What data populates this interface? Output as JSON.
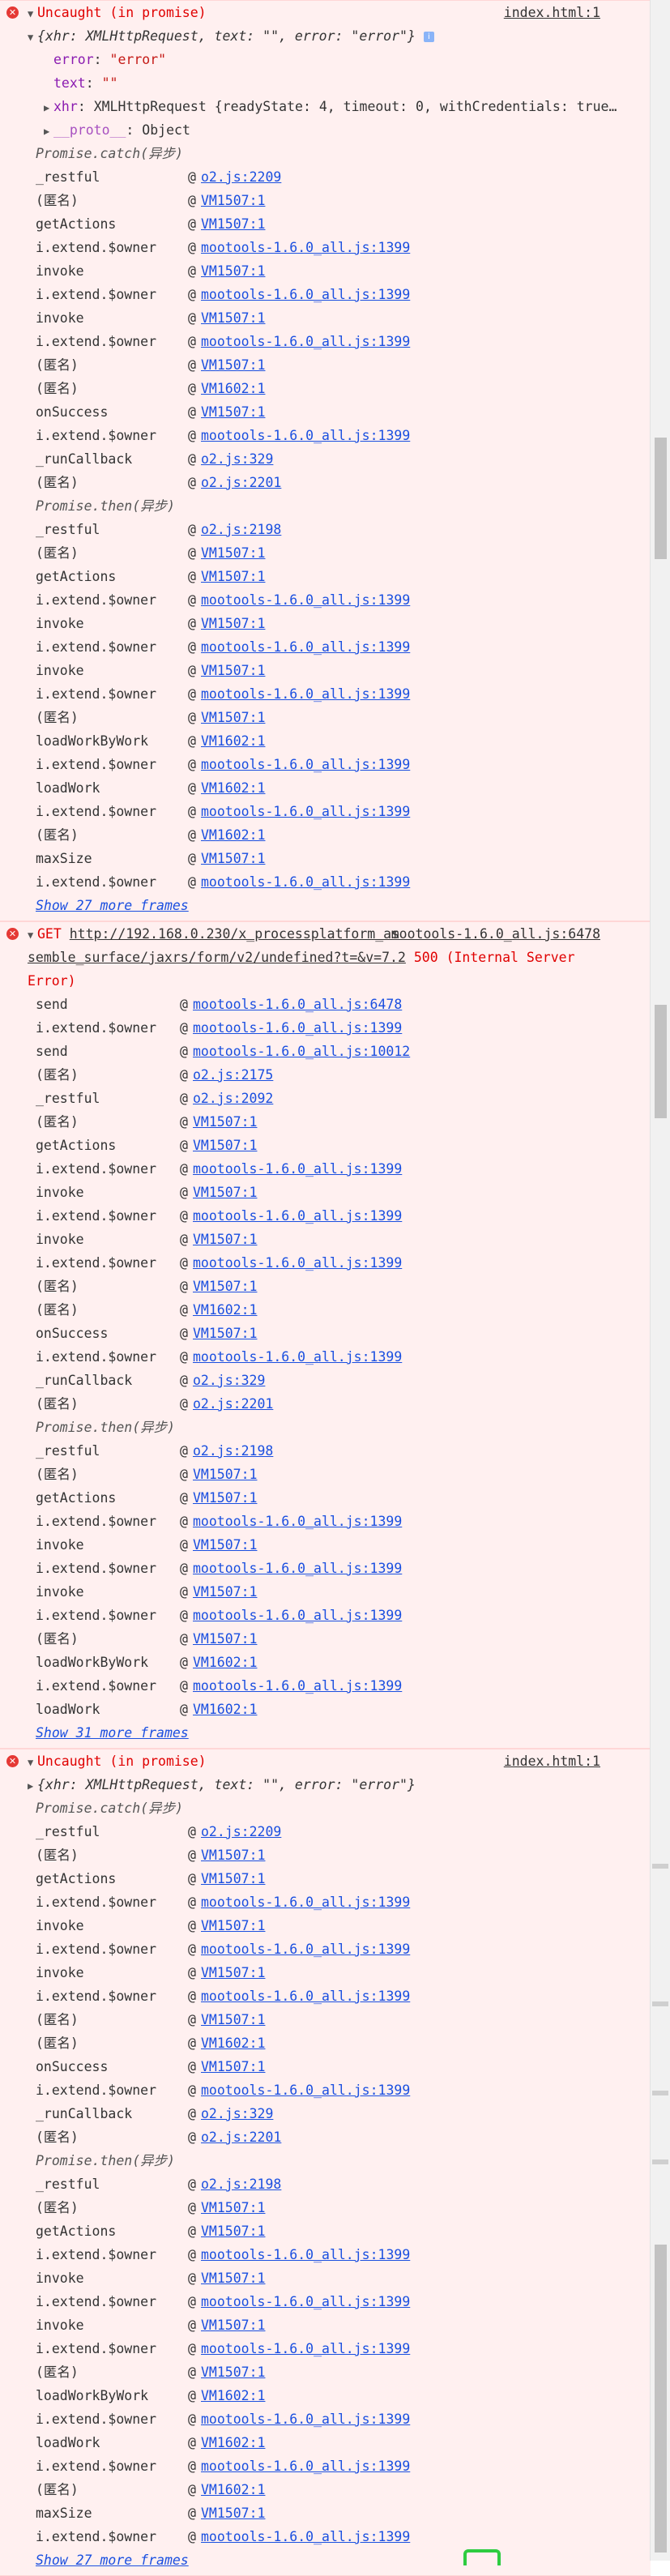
{
  "msg1": {
    "title": "Uncaught (in promise)",
    "source": "index.html:1",
    "object_summary": "{xhr: XMLHttpRequest, text: \"\", error: \"error\"}",
    "prop_error_key": "error",
    "prop_error_val": "\"error\"",
    "prop_text_key": "text",
    "prop_text_val": "\"\"",
    "prop_xhr_key": "xhr",
    "prop_xhr_val": "XMLHttpRequest {readyState: 4, timeout: 0, withCredentials: true…",
    "prop_proto_key": "__proto__",
    "prop_proto_val": "Object",
    "async1": "Promise.catch(异步)",
    "frames1": [
      {
        "fn": "_restful",
        "loc": "o2.js:2209"
      },
      {
        "fn": "(匿名)",
        "loc": "VM1507:1"
      },
      {
        "fn": "getActions",
        "loc": "VM1507:1"
      },
      {
        "fn": "i.extend.$owner",
        "loc": "mootools-1.6.0_all.js:1399"
      },
      {
        "fn": "invoke",
        "loc": "VM1507:1"
      },
      {
        "fn": "i.extend.$owner",
        "loc": "mootools-1.6.0_all.js:1399"
      },
      {
        "fn": "invoke",
        "loc": "VM1507:1"
      },
      {
        "fn": "i.extend.$owner",
        "loc": "mootools-1.6.0_all.js:1399"
      },
      {
        "fn": "(匿名)",
        "loc": "VM1507:1"
      },
      {
        "fn": "(匿名)",
        "loc": "VM1602:1"
      },
      {
        "fn": "onSuccess",
        "loc": "VM1507:1"
      },
      {
        "fn": "i.extend.$owner",
        "loc": "mootools-1.6.0_all.js:1399"
      },
      {
        "fn": "_runCallback",
        "loc": "o2.js:329"
      },
      {
        "fn": "(匿名)",
        "loc": "o2.js:2201"
      }
    ],
    "async2": "Promise.then(异步)",
    "frames2": [
      {
        "fn": "_restful",
        "loc": "o2.js:2198"
      },
      {
        "fn": "(匿名)",
        "loc": "VM1507:1"
      },
      {
        "fn": "getActions",
        "loc": "VM1507:1"
      },
      {
        "fn": "i.extend.$owner",
        "loc": "mootools-1.6.0_all.js:1399"
      },
      {
        "fn": "invoke",
        "loc": "VM1507:1"
      },
      {
        "fn": "i.extend.$owner",
        "loc": "mootools-1.6.0_all.js:1399"
      },
      {
        "fn": "invoke",
        "loc": "VM1507:1"
      },
      {
        "fn": "i.extend.$owner",
        "loc": "mootools-1.6.0_all.js:1399"
      },
      {
        "fn": "(匿名)",
        "loc": "VM1507:1"
      },
      {
        "fn": "loadWorkByWork",
        "loc": "VM1602:1"
      },
      {
        "fn": "i.extend.$owner",
        "loc": "mootools-1.6.0_all.js:1399"
      },
      {
        "fn": "loadWork",
        "loc": "VM1602:1"
      },
      {
        "fn": "i.extend.$owner",
        "loc": "mootools-1.6.0_all.js:1399"
      },
      {
        "fn": "(匿名)",
        "loc": "VM1602:1"
      },
      {
        "fn": "maxSize",
        "loc": "VM1507:1"
      },
      {
        "fn": "i.extend.$owner",
        "loc": "mootools-1.6.0_all.js:1399"
      }
    ],
    "more": "Show 27 more frames"
  },
  "msg2": {
    "method": "GET",
    "url_line1": "http://192.168.0.230/x_processplatform_as",
    "url_line2": "semble_surface/jaxrs/form/v2/undefined?t=&v=7.2",
    "status": "500 (Internal Server",
    "status2": "Error)",
    "source": "mootools-1.6.0_all.js:6478",
    "frames1": [
      {
        "fn": "send",
        "loc": "mootools-1.6.0_all.js:6478"
      },
      {
        "fn": "i.extend.$owner",
        "loc": "mootools-1.6.0_all.js:1399"
      },
      {
        "fn": "send",
        "loc": "mootools-1.6.0_all.js:10012"
      },
      {
        "fn": "(匿名)",
        "loc": "o2.js:2175"
      },
      {
        "fn": "_restful",
        "loc": "o2.js:2092"
      },
      {
        "fn": "(匿名)",
        "loc": "VM1507:1"
      },
      {
        "fn": "getActions",
        "loc": "VM1507:1"
      },
      {
        "fn": "i.extend.$owner",
        "loc": "mootools-1.6.0_all.js:1399"
      },
      {
        "fn": "invoke",
        "loc": "VM1507:1"
      },
      {
        "fn": "i.extend.$owner",
        "loc": "mootools-1.6.0_all.js:1399"
      },
      {
        "fn": "invoke",
        "loc": "VM1507:1"
      },
      {
        "fn": "i.extend.$owner",
        "loc": "mootools-1.6.0_all.js:1399"
      },
      {
        "fn": "(匿名)",
        "loc": "VM1507:1"
      },
      {
        "fn": "(匿名)",
        "loc": "VM1602:1"
      },
      {
        "fn": "onSuccess",
        "loc": "VM1507:1"
      },
      {
        "fn": "i.extend.$owner",
        "loc": "mootools-1.6.0_all.js:1399"
      },
      {
        "fn": "_runCallback",
        "loc": "o2.js:329"
      },
      {
        "fn": "(匿名)",
        "loc": "o2.js:2201"
      }
    ],
    "async2": "Promise.then(异步)",
    "frames2": [
      {
        "fn": "_restful",
        "loc": "o2.js:2198"
      },
      {
        "fn": "(匿名)",
        "loc": "VM1507:1"
      },
      {
        "fn": "getActions",
        "loc": "VM1507:1"
      },
      {
        "fn": "i.extend.$owner",
        "loc": "mootools-1.6.0_all.js:1399"
      },
      {
        "fn": "invoke",
        "loc": "VM1507:1"
      },
      {
        "fn": "i.extend.$owner",
        "loc": "mootools-1.6.0_all.js:1399"
      },
      {
        "fn": "invoke",
        "loc": "VM1507:1"
      },
      {
        "fn": "i.extend.$owner",
        "loc": "mootools-1.6.0_all.js:1399"
      },
      {
        "fn": "(匿名)",
        "loc": "VM1507:1"
      },
      {
        "fn": "loadWorkByWork",
        "loc": "VM1602:1"
      },
      {
        "fn": "i.extend.$owner",
        "loc": "mootools-1.6.0_all.js:1399"
      },
      {
        "fn": "loadWork",
        "loc": "VM1602:1"
      }
    ],
    "more": "Show 31 more frames"
  },
  "msg3": {
    "title": "Uncaught (in promise)",
    "source": "index.html:1",
    "object_summary": "{xhr: XMLHttpRequest, text: \"\", error: \"error\"}",
    "async1": "Promise.catch(异步)",
    "frames1": [
      {
        "fn": "_restful",
        "loc": "o2.js:2209"
      },
      {
        "fn": "(匿名)",
        "loc": "VM1507:1"
      },
      {
        "fn": "getActions",
        "loc": "VM1507:1"
      },
      {
        "fn": "i.extend.$owner",
        "loc": "mootools-1.6.0_all.js:1399"
      },
      {
        "fn": "invoke",
        "loc": "VM1507:1"
      },
      {
        "fn": "i.extend.$owner",
        "loc": "mootools-1.6.0_all.js:1399"
      },
      {
        "fn": "invoke",
        "loc": "VM1507:1"
      },
      {
        "fn": "i.extend.$owner",
        "loc": "mootools-1.6.0_all.js:1399"
      },
      {
        "fn": "(匿名)",
        "loc": "VM1507:1"
      },
      {
        "fn": "(匿名)",
        "loc": "VM1602:1"
      },
      {
        "fn": "onSuccess",
        "loc": "VM1507:1"
      },
      {
        "fn": "i.extend.$owner",
        "loc": "mootools-1.6.0_all.js:1399"
      },
      {
        "fn": "_runCallback",
        "loc": "o2.js:329"
      },
      {
        "fn": "(匿名)",
        "loc": "o2.js:2201"
      }
    ],
    "async2": "Promise.then(异步)",
    "frames2": [
      {
        "fn": "_restful",
        "loc": "o2.js:2198"
      },
      {
        "fn": "(匿名)",
        "loc": "VM1507:1"
      },
      {
        "fn": "getActions",
        "loc": "VM1507:1"
      },
      {
        "fn": "i.extend.$owner",
        "loc": "mootools-1.6.0_all.js:1399"
      },
      {
        "fn": "invoke",
        "loc": "VM1507:1"
      },
      {
        "fn": "i.extend.$owner",
        "loc": "mootools-1.6.0_all.js:1399"
      },
      {
        "fn": "invoke",
        "loc": "VM1507:1"
      },
      {
        "fn": "i.extend.$owner",
        "loc": "mootools-1.6.0_all.js:1399"
      },
      {
        "fn": "(匿名)",
        "loc": "VM1507:1"
      },
      {
        "fn": "loadWorkByWork",
        "loc": "VM1602:1"
      },
      {
        "fn": "i.extend.$owner",
        "loc": "mootools-1.6.0_all.js:1399"
      },
      {
        "fn": "loadWork",
        "loc": "VM1602:1"
      },
      {
        "fn": "i.extend.$owner",
        "loc": "mootools-1.6.0_all.js:1399"
      },
      {
        "fn": "(匿名)",
        "loc": "VM1602:1"
      },
      {
        "fn": "maxSize",
        "loc": "VM1507:1"
      },
      {
        "fn": "i.extend.$owner",
        "loc": "mootools-1.6.0_all.js:1399"
      }
    ],
    "more": "Show 27 more frames"
  }
}
